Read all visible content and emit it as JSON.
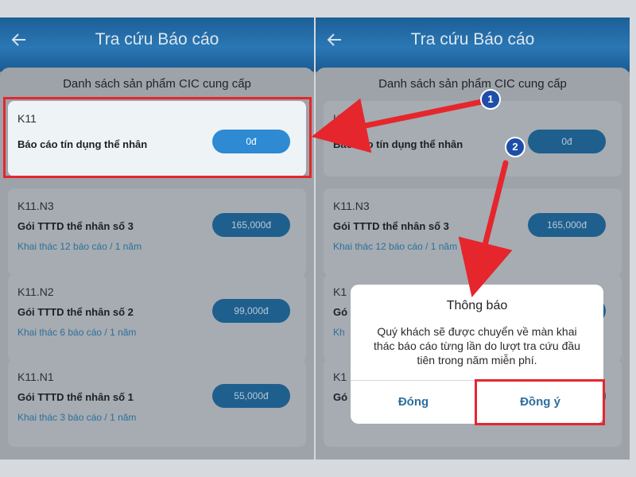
{
  "header": {
    "title": "Tra cứu Báo cáo"
  },
  "list_title": "Danh sách sản phẩm CIC cung cấp",
  "products": [
    {
      "code": "K11",
      "name": "Báo cáo tín dụng thể nhân",
      "price": "0đ",
      "sub": ""
    },
    {
      "code": "K11.N3",
      "name": "Gói TTTD thể nhân số 3",
      "price": "165,000đ",
      "sub": "Khai thác 12 báo cáo / 1 năm"
    },
    {
      "code": "K11.N2",
      "name": "Gói TTTD thể nhân số 2",
      "price": "99,000đ",
      "sub": "Khai thác 6 báo cáo / 1 năm"
    },
    {
      "code": "K11.N1",
      "name": "Gói TTTD thể nhân số 1",
      "price": "55,000đ",
      "sub": "Khai thác 3 báo cáo / 1 năm"
    }
  ],
  "right_partial_codes": [
    "K11",
    "K11.N3",
    "K1",
    "K1"
  ],
  "right_partial_names": [
    "Gó",
    "Gó"
  ],
  "right_partial_subs": [
    "Kh"
  ],
  "dialog": {
    "title": "Thông báo",
    "message": "Quý khách sẽ được chuyển về màn khai thác báo cáo từng lần do lượt tra cứu đầu tiên trong năm miễn phí.",
    "cancel": "Đóng",
    "confirm": "Đồng ý"
  },
  "steps": [
    "1",
    "2"
  ],
  "colors": {
    "header": "#2a77b4",
    "highlight": "#e5262d",
    "button": "#2d8ad3",
    "step_badge": "#1e4fa8"
  },
  "icons": {
    "back": "arrow-left-icon"
  }
}
